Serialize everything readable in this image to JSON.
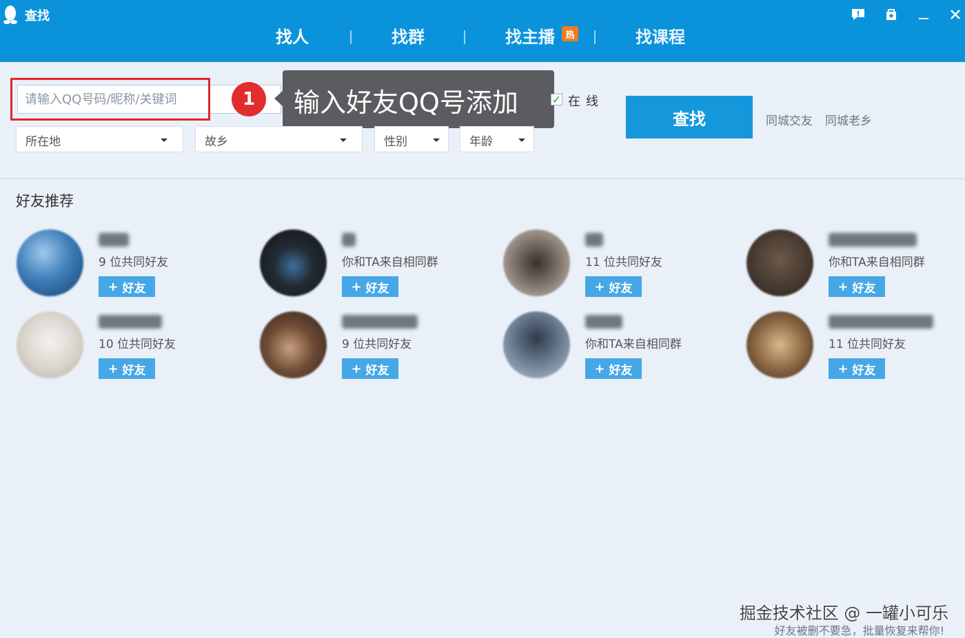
{
  "window": {
    "title": "查找",
    "icons": [
      "qq-penguin-icon",
      "feedback-icon",
      "skin-icon",
      "minimize-icon",
      "close-icon"
    ]
  },
  "tabs": [
    {
      "label": "找人",
      "active": true
    },
    {
      "label": "找群",
      "active": false
    },
    {
      "label": "找主播",
      "active": false,
      "badge": "热"
    },
    {
      "label": "找课程",
      "active": false
    }
  ],
  "search": {
    "placeholder": "请输入QQ号码/昵称/关键词",
    "value": "",
    "online_label": "在线",
    "online_checked": true,
    "button_label": "查找",
    "quick_links": [
      "同城交友",
      "同城老乡"
    ]
  },
  "filters": [
    {
      "label": "所在地"
    },
    {
      "label": "故乡"
    },
    {
      "label": "性别"
    },
    {
      "label": "年龄"
    }
  ],
  "annotation": {
    "step": "1",
    "text": "输入好友QQ号添加",
    "color": "#e0262b"
  },
  "recommend": {
    "title": "好友推荐",
    "add_label": "好友",
    "items": [
      {
        "mutual": "9 位共同好友"
      },
      {
        "mutual": "你和TA来自相同群"
      },
      {
        "mutual": "11 位共同好友"
      },
      {
        "mutual": "你和TA来自相同群"
      },
      {
        "mutual": "10 位共同好友"
      },
      {
        "mutual": "9 位共同好友"
      },
      {
        "mutual": "你和TA来自相同群"
      },
      {
        "mutual": "11 位共同好友"
      }
    ]
  },
  "watermark": {
    "main": "掘金技术社区 @ 一罐小可乐",
    "sub": "好友被删不要急，批量恢复来帮你!"
  },
  "colors": {
    "titlebar": "#0a93da",
    "primary_button": "#1597db",
    "add_button": "#46a7e6",
    "background": "#eaf0f8"
  }
}
